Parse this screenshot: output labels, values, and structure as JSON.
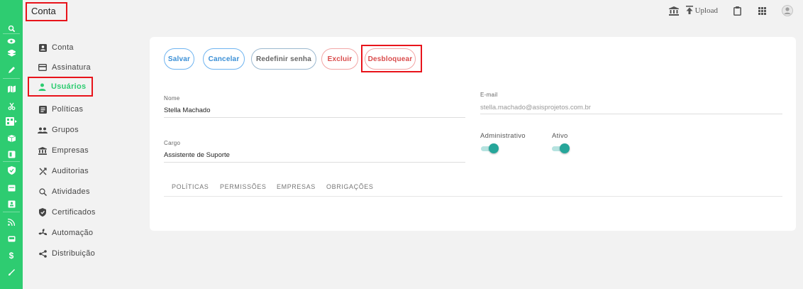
{
  "app": {
    "accent": "#2ecc71",
    "highlight": "#e8141b"
  },
  "rail": {
    "icons": [
      "search-icon",
      "eye-icon",
      "layers-icon",
      "pencil-icon",
      "map-icon",
      "scissors-icon",
      "qr-icon",
      "box-icon",
      "book-icon",
      "shield-icon",
      "calendar-icon",
      "id-card-icon",
      "rss-icon",
      "bus-icon",
      "dollar-icon",
      "brush-icon"
    ]
  },
  "header": {
    "title": "Conta",
    "upload_label": "Upload"
  },
  "nav": {
    "items": [
      {
        "label": "Conta",
        "icon": "account-box-icon"
      },
      {
        "label": "Assinatura",
        "icon": "credit-card-icon"
      },
      {
        "label": "Usuários",
        "icon": "person-icon"
      },
      {
        "label": "Políticas",
        "icon": "policy-icon"
      },
      {
        "label": "Grupos",
        "icon": "group-icon"
      },
      {
        "label": "Empresas",
        "icon": "bank-icon"
      },
      {
        "label": "Auditorias",
        "icon": "audit-icon"
      },
      {
        "label": "Atividades",
        "icon": "magnify-icon"
      },
      {
        "label": "Certificados",
        "icon": "shield-icon"
      },
      {
        "label": "Automação",
        "icon": "fan-icon"
      },
      {
        "label": "Distribuição",
        "icon": "share-icon"
      }
    ],
    "active_index": 2
  },
  "actions": {
    "save": "Salvar",
    "cancel": "Cancelar",
    "reset_password": "Redefinir senha",
    "delete": "Excluir",
    "unlock": "Desbloquear"
  },
  "form": {
    "name_label": "Nome",
    "name_value": "Stella Machado",
    "email_label": "E-mail",
    "email_value": "stella.machado@asisprojetos.com.br",
    "role_label": "Cargo",
    "role_value": "Assistente de Suporte",
    "admin_label": "Administrativo",
    "admin_on": true,
    "active_label": "Ativo",
    "active_on": true
  },
  "tabs": [
    "POLÍTICAS",
    "PERMISSÕES",
    "EMPRESAS",
    "OBRIGAÇÕES"
  ]
}
